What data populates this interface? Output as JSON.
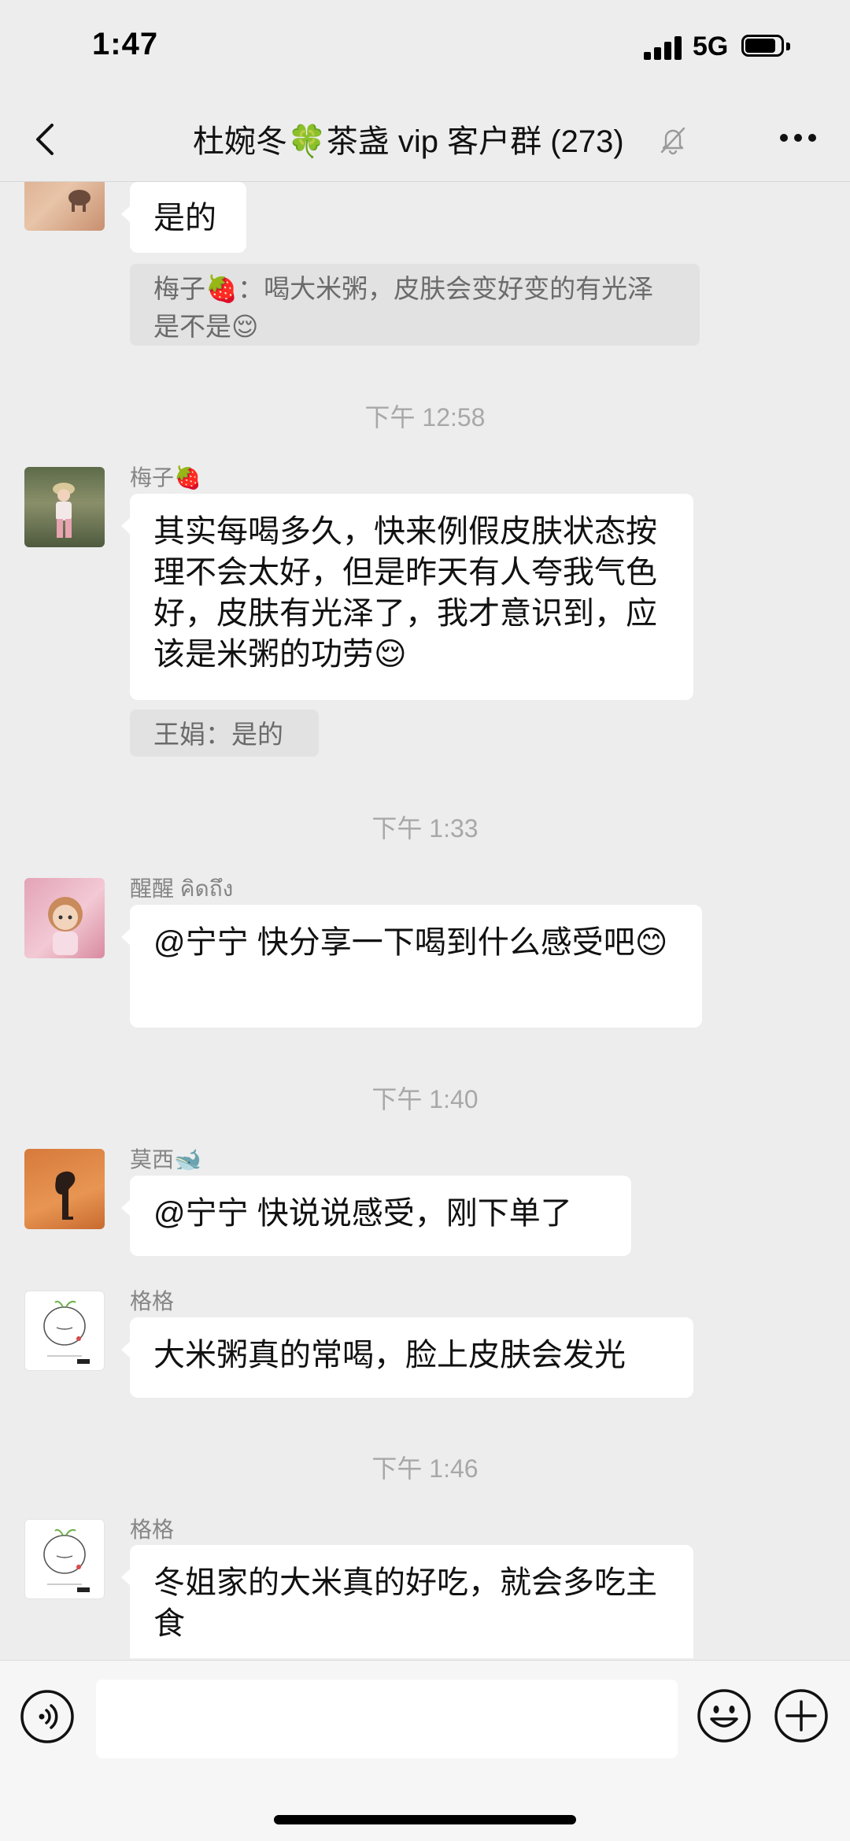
{
  "status": {
    "time": "1:47",
    "network": "5G"
  },
  "header": {
    "title": "杜婉冬🍀茶盏 vip 客户群 (273)"
  },
  "messages": [
    {
      "text": "是的",
      "quote": "梅子🍓：喝大米粥，皮肤会变好变的有光泽是不是😌"
    },
    {
      "timestamp": "下午 12:58",
      "sender": "梅子🍓",
      "text": "其实每喝多久，快来例假皮肤状态按理不会太好，但是昨天有人夸我气色好，皮肤有光泽了，我才意识到，应该是米粥的功劳😌",
      "quote": "王娟：是的"
    },
    {
      "timestamp": "下午 1:33",
      "sender": "醒醒 คิดถึง",
      "text": "@宁宁 快分享一下喝到什么感受吧😊"
    },
    {
      "timestamp": "下午 1:40",
      "sender": "莫西🐋",
      "text": "@宁宁 快说说感受，刚下单了"
    },
    {
      "sender": "格格",
      "text": "大米粥真的常喝，脸上皮肤会发光"
    },
    {
      "timestamp": "下午 1:46",
      "sender": "格格",
      "text": "冬姐家的大米真的好吃，就会多吃主食"
    }
  ],
  "input": {
    "placeholder": ""
  }
}
